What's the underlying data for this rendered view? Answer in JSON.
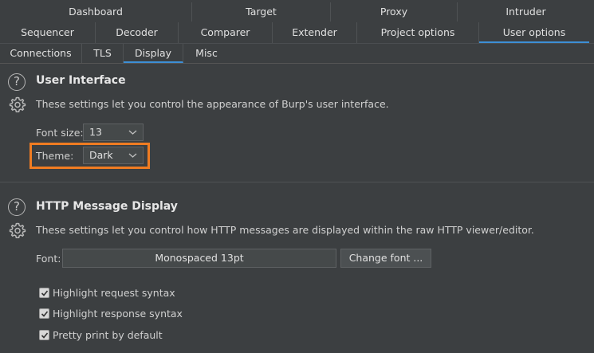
{
  "tabs_row1": [
    {
      "label": "Dashboard"
    },
    {
      "label": "Target"
    },
    {
      "label": "Proxy"
    },
    {
      "label": "Intruder"
    }
  ],
  "tabs_row2": [
    {
      "label": "Sequencer"
    },
    {
      "label": "Decoder"
    },
    {
      "label": "Comparer"
    },
    {
      "label": "Extender"
    },
    {
      "label": "Project options"
    },
    {
      "label": "User options"
    }
  ],
  "subtabs": [
    {
      "label": "Connections"
    },
    {
      "label": "TLS"
    },
    {
      "label": "Display"
    },
    {
      "label": "Misc"
    }
  ],
  "active_tab": "User options",
  "active_subtab": "Display",
  "user_interface": {
    "title": "User Interface",
    "description": "These settings let you control the appearance of Burp's user interface.",
    "font_size_label": "Font size:",
    "font_size_value": "13",
    "theme_label": "Theme:",
    "theme_value": "Dark"
  },
  "http_display": {
    "title": "HTTP Message Display",
    "description": "These settings let you control how HTTP messages are displayed within the raw HTTP viewer/editor.",
    "font_label": "Font:",
    "font_value": "Monospaced 13pt",
    "change_font_label": "Change font ...",
    "checkboxes": [
      {
        "label": "Highlight request syntax",
        "checked": true
      },
      {
        "label": "Highlight response syntax",
        "checked": true
      },
      {
        "label": "Pretty print by default",
        "checked": true
      }
    ]
  },
  "colors": {
    "accent": "#3d8fd6",
    "highlight": "#f07c22",
    "background": "#3c3f41"
  },
  "icons": [
    "help-icon",
    "gear-icon",
    "chevron-down-icon",
    "checkmark-icon"
  ]
}
